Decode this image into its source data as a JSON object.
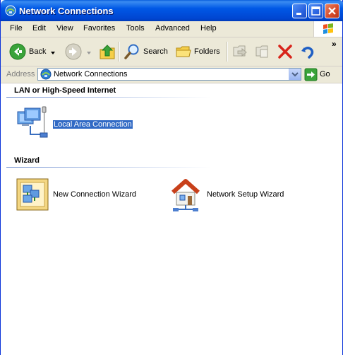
{
  "window": {
    "title": "Network Connections"
  },
  "menu": {
    "items": [
      "File",
      "Edit",
      "View",
      "Favorites",
      "Tools",
      "Advanced",
      "Help"
    ]
  },
  "toolbar": {
    "back_label": "Back",
    "search_label": "Search",
    "folders_label": "Folders",
    "overflow": "»"
  },
  "address": {
    "label": "Address",
    "value": "Network Connections",
    "go_label": "Go"
  },
  "groups": [
    {
      "header": "LAN or High-Speed Internet",
      "items": [
        {
          "label": "Local Area Connection",
          "selected": true
        }
      ]
    },
    {
      "header": "Wizard",
      "items": [
        {
          "label": "New Connection Wizard"
        },
        {
          "label": "Network Setup Wizard"
        }
      ]
    }
  ],
  "colors": {
    "titlebar": "#0058e6",
    "selection": "#316ac5",
    "chrome": "#ece9d8",
    "close_button": "#d64a2a"
  },
  "icons": [
    "network-connections-icon",
    "minimize-icon",
    "maximize-icon",
    "close-icon",
    "windows-logo-icon",
    "back-arrow-icon",
    "forward-arrow-icon",
    "up-folder-icon",
    "search-icon",
    "folders-icon",
    "move-to-icon",
    "copy-to-icon",
    "delete-icon",
    "undo-icon",
    "go-arrow-icon",
    "local-area-connection-icon",
    "new-connection-wizard-icon",
    "network-setup-wizard-icon"
  ]
}
